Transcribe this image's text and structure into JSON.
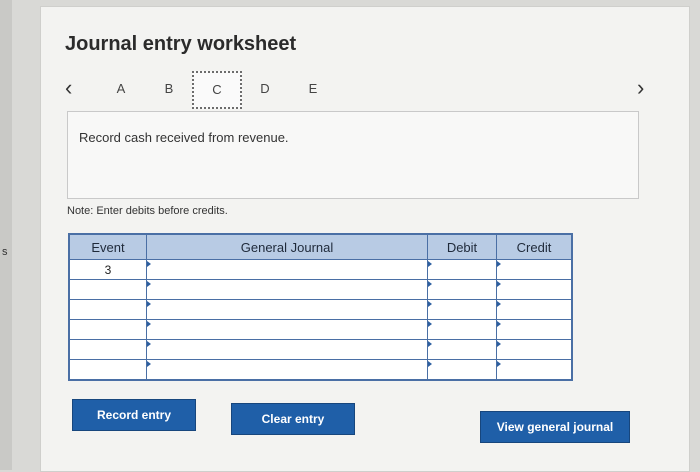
{
  "edge_char": "s",
  "title": "Journal entry worksheet",
  "nav": {
    "tabs": [
      "A",
      "B",
      "C",
      "D",
      "E"
    ],
    "active_tab": "C"
  },
  "prompt": "Record cash received from revenue.",
  "note": "Note: Enter debits before credits.",
  "table": {
    "headers": [
      "Event",
      "General Journal",
      "Debit",
      "Credit"
    ],
    "rows": [
      {
        "event": "3",
        "account": "",
        "debit": "",
        "credit": ""
      },
      {
        "event": "",
        "account": "",
        "debit": "",
        "credit": ""
      },
      {
        "event": "",
        "account": "",
        "debit": "",
        "credit": ""
      },
      {
        "event": "",
        "account": "",
        "debit": "",
        "credit": ""
      },
      {
        "event": "",
        "account": "",
        "debit": "",
        "credit": ""
      },
      {
        "event": "",
        "account": "",
        "debit": "",
        "credit": ""
      }
    ]
  },
  "buttons": {
    "record": "Record entry",
    "clear": "Clear entry",
    "view": "View general journal"
  },
  "colors": {
    "button": "#1f5fa8",
    "table_header": "#b8cbe4",
    "table_border": "#4a6fa5"
  }
}
